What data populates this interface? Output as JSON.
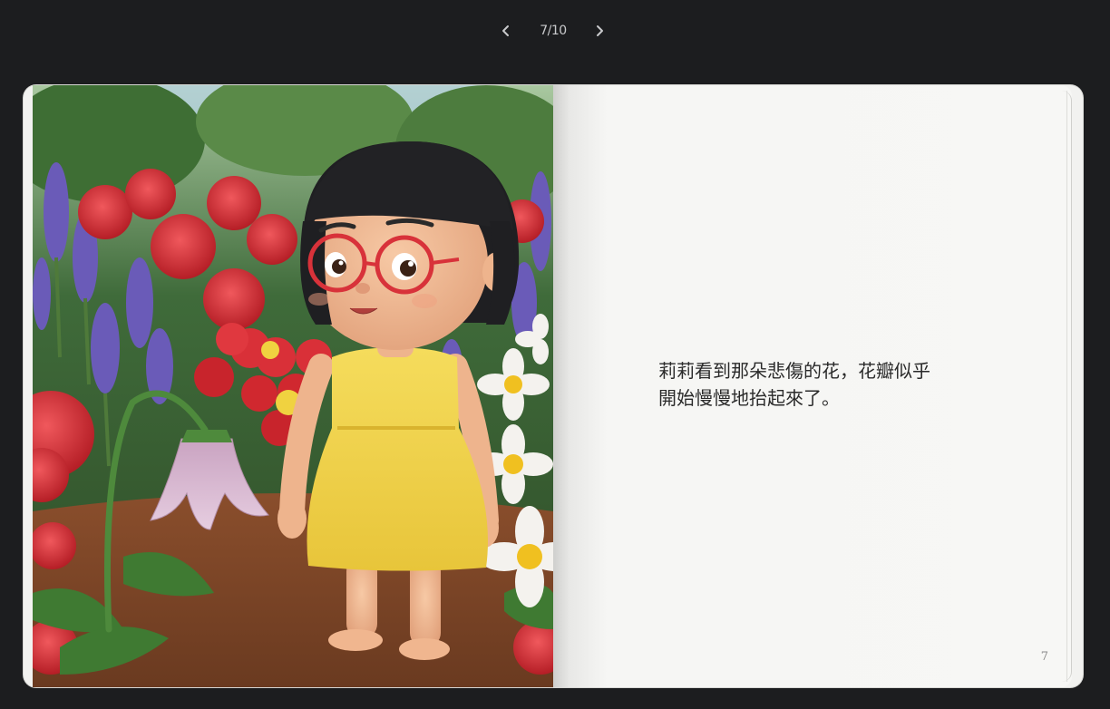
{
  "navigation": {
    "prev_icon": "chevron-left-icon",
    "next_icon": "chevron-right-icon",
    "page_counter": "7/10"
  },
  "book": {
    "illustration_alt": "Girl with red glasses in a flower garden",
    "story_text_line1": "莉莉看到那朵悲傷的花，花瓣似乎",
    "story_text_line2": "開始慢慢地抬起來了。",
    "page_number": "7"
  },
  "colors": {
    "background": "#1c1d1f",
    "page": "#f7f7f5",
    "text": "#2a2a2a",
    "dress": "#f2d34a",
    "glasses": "#d8323a"
  }
}
